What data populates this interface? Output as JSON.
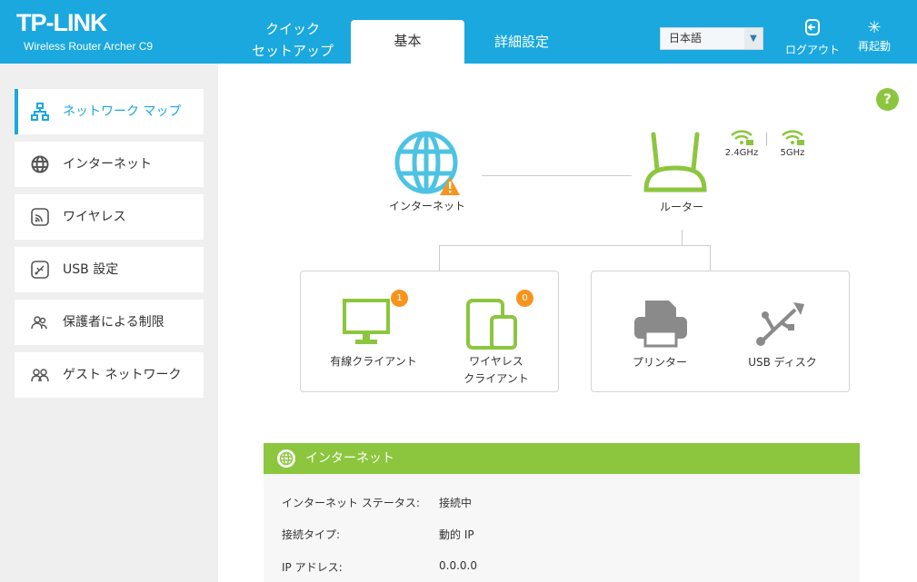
{
  "header": {
    "brand": "TP-LINK",
    "model": "Wireless Router Archer C9",
    "tabs": [
      {
        "label_1": "クイック",
        "label_2": "セットアップ"
      },
      {
        "label": "基本"
      },
      {
        "label": "詳細設定"
      }
    ],
    "language": "日本語",
    "logout": "ログアウト",
    "reboot": "再起動"
  },
  "sidebar": {
    "items": [
      {
        "label": "ネットワーク マップ",
        "icon": "network-map-icon",
        "active": true
      },
      {
        "label": "インターネット",
        "icon": "globe-icon"
      },
      {
        "label": "ワイヤレス",
        "icon": "wireless-icon"
      },
      {
        "label": "USB 設定",
        "icon": "usb-icon"
      },
      {
        "label": "保護者による制限",
        "icon": "parental-icon"
      },
      {
        "label": "ゲスト ネットワーク",
        "icon": "guest-icon"
      }
    ]
  },
  "map": {
    "internet": "インターネット",
    "router": "ルーター",
    "band1": "2.4GHz",
    "band2": "5GHz",
    "wired": {
      "label": "有線クライアント",
      "count": "1"
    },
    "wireless": {
      "label_1": "ワイヤレス",
      "label_2": "クライアント",
      "count": "0"
    },
    "printer": "プリンター",
    "usb": "USB ディスク"
  },
  "panel": {
    "title": "インターネット",
    "rows": [
      {
        "k": "インターネット ステータス:",
        "v": "接続中"
      },
      {
        "k": "接続タイプ:",
        "v": "動的 IP"
      },
      {
        "k": "IP アドレス:",
        "v": "0.0.0.0"
      }
    ]
  },
  "colors": {
    "header": "#1aa8df",
    "green": "#8cc63e",
    "orange": "#f7941d",
    "globe": "#4cc3e3"
  }
}
